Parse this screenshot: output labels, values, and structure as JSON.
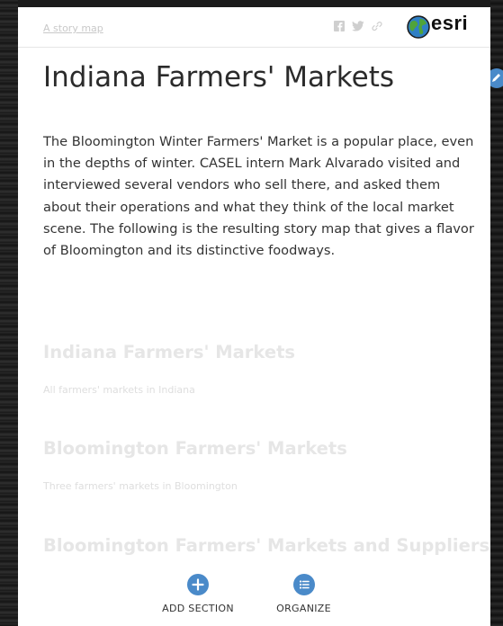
{
  "header": {
    "story_link": "A story map",
    "share_icons": [
      "facebook-icon",
      "twitter-icon",
      "link-icon"
    ],
    "brand": "esri"
  },
  "story": {
    "title": "Indiana Farmers' Markets",
    "intro": "The Bloomington Winter Farmers' Market is a popular place, even in the depths of winter. CASEL intern Mark Alvarado visited and interviewed several vendors who sell there, and asked them about their operations and what they think of the local market scene. The following is the resulting story map that gives a flavor of Bloomington and its distinctive foodways."
  },
  "sections": [
    {
      "title": "Indiana Farmers' Markets",
      "subtitle": "All farmers' markets in Indiana"
    },
    {
      "title": "Bloomington Farmers' Markets",
      "subtitle": "Three farmers' markets in Bloomington"
    },
    {
      "title": "Bloomington Farmers' Markets and Suppliers",
      "subtitle": ""
    }
  ],
  "actions": {
    "add_section": "ADD SECTION",
    "organize": "ORGANIZE"
  },
  "colors": {
    "accent": "#4a8ac9",
    "section_title": "#e6e6e6"
  }
}
